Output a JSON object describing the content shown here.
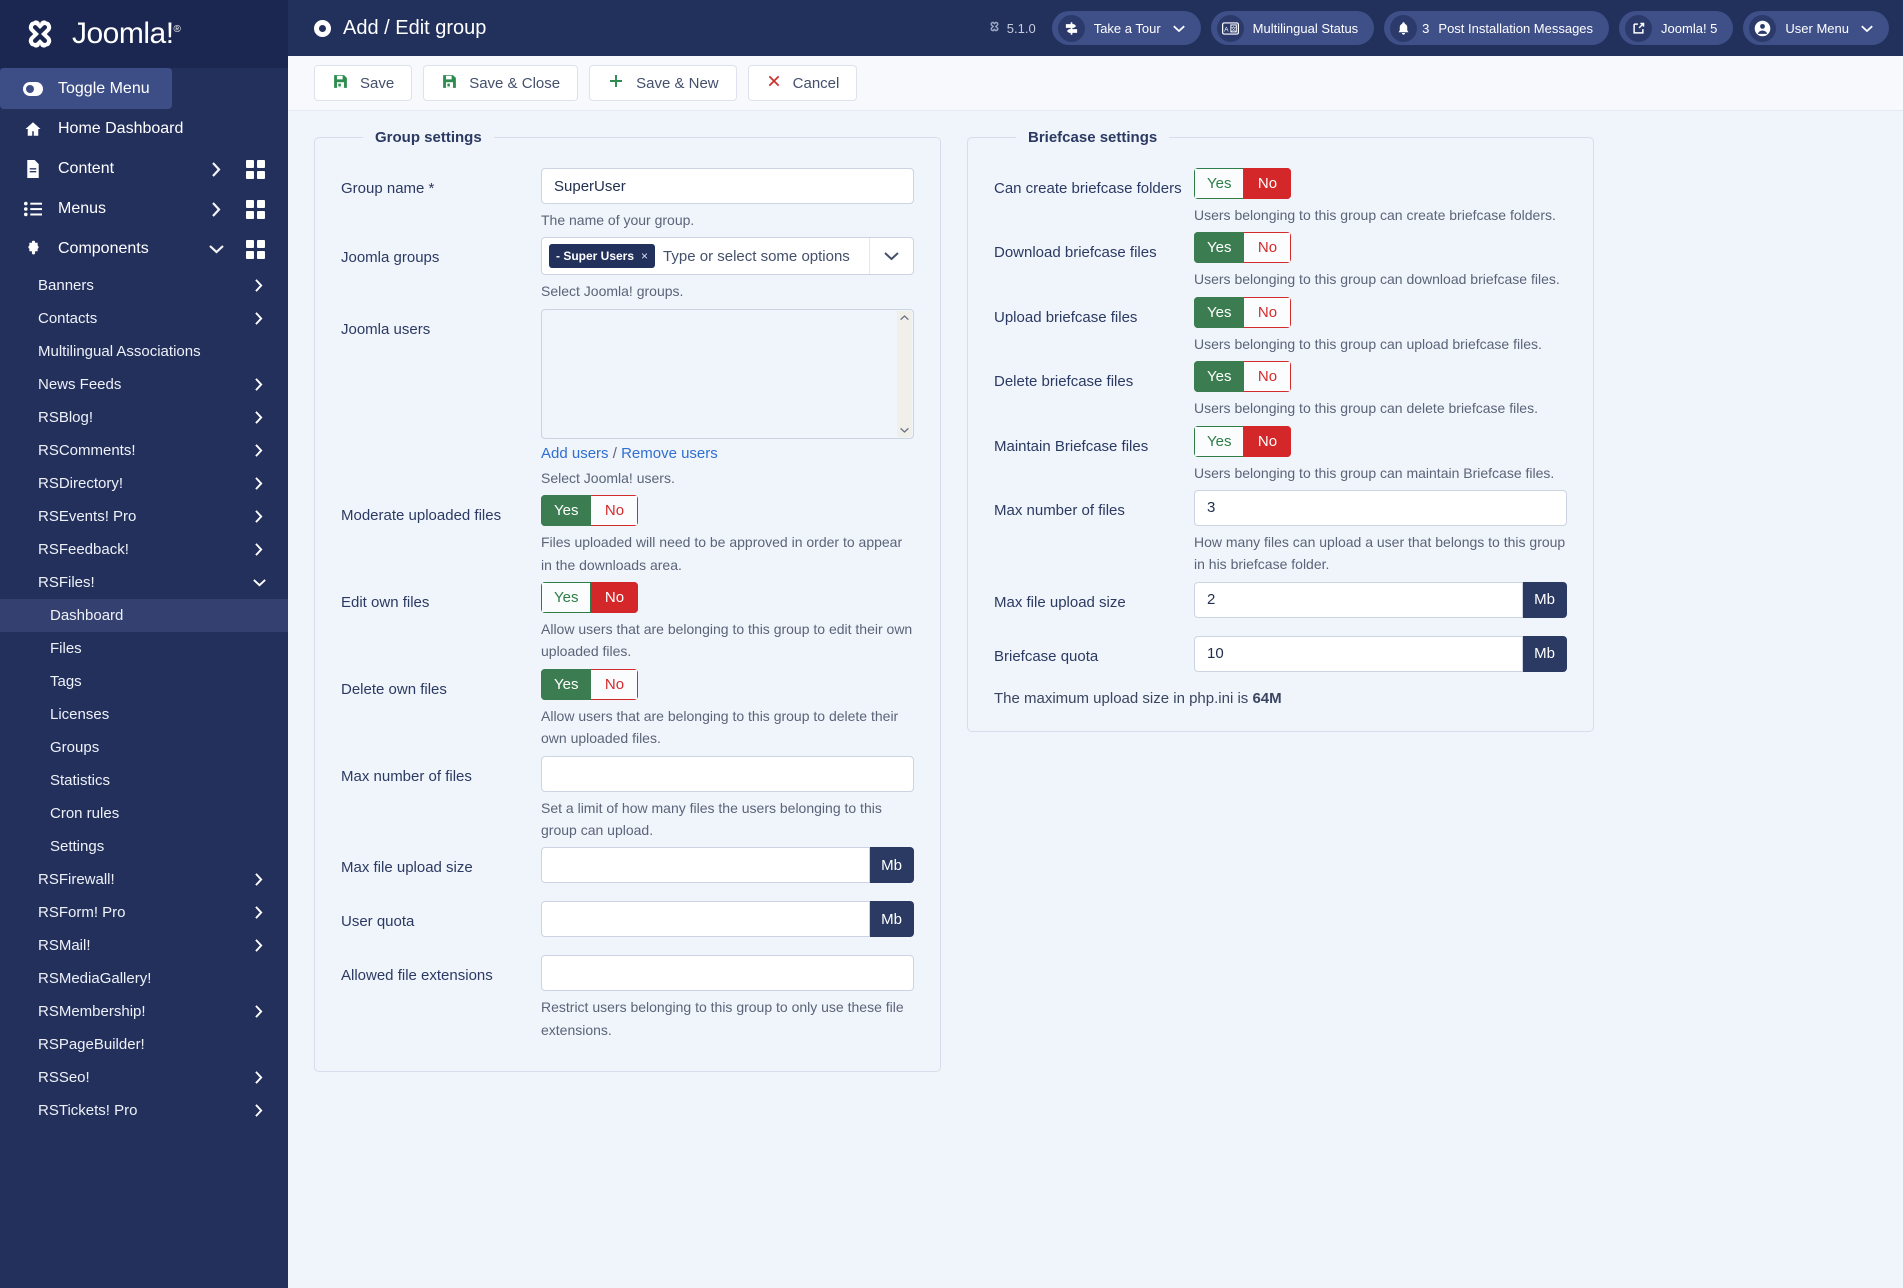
{
  "brand": {
    "name": "Joomla!",
    "reg": "®"
  },
  "sidebar": {
    "toggle_label": "Toggle Menu",
    "top_items": [
      {
        "label": "Home Dashboard",
        "icon": "home-icon",
        "chevron": false,
        "grid": false
      },
      {
        "label": "Content",
        "icon": "document-icon",
        "chevron": true,
        "grid": true
      },
      {
        "label": "Menus",
        "icon": "list-icon",
        "chevron": true,
        "grid": true
      },
      {
        "label": "Components",
        "icon": "puzzle-icon",
        "chevron": "down",
        "grid": true
      }
    ],
    "components": [
      {
        "label": "Banners",
        "chevron": true
      },
      {
        "label": "Contacts",
        "chevron": true
      },
      {
        "label": "Multilingual Associations",
        "chevron": false
      },
      {
        "label": "News Feeds",
        "chevron": true
      },
      {
        "label": "RSBlog!",
        "chevron": true
      },
      {
        "label": "RSComments!",
        "chevron": true
      },
      {
        "label": "RSDirectory!",
        "chevron": true
      },
      {
        "label": "RSEvents! Pro",
        "chevron": true
      },
      {
        "label": "RSFeedback!",
        "chevron": true
      },
      {
        "label": "RSFiles!",
        "chevron": "down"
      }
    ],
    "rsfiles_children": [
      {
        "label": "Dashboard",
        "active": true
      },
      {
        "label": "Files",
        "active": false
      },
      {
        "label": "Tags",
        "active": false
      },
      {
        "label": "Licenses",
        "active": false
      },
      {
        "label": "Groups",
        "active": false
      },
      {
        "label": "Statistics",
        "active": false
      },
      {
        "label": "Cron rules",
        "active": false
      },
      {
        "label": "Settings",
        "active": false
      }
    ],
    "components_after": [
      {
        "label": "RSFirewall!",
        "chevron": true
      },
      {
        "label": "RSForm! Pro",
        "chevron": true
      },
      {
        "label": "RSMail!",
        "chevron": true
      },
      {
        "label": "RSMediaGallery!",
        "chevron": false
      },
      {
        "label": "RSMembership!",
        "chevron": true
      },
      {
        "label": "RSPageBuilder!",
        "chevron": false
      },
      {
        "label": "RSSeo!",
        "chevron": true
      },
      {
        "label": "RSTickets! Pro",
        "chevron": true
      }
    ]
  },
  "header": {
    "title": "Add / Edit group",
    "version": "5.1.0",
    "take_a_tour": "Take a Tour",
    "multilingual_status": "Multilingual Status",
    "messages_count": "3",
    "post_installation_messages": "Post Installation Messages",
    "joomla_5": "Joomla! 5",
    "user_menu": "User Menu"
  },
  "toolbar": {
    "save": "Save",
    "save_close": "Save & Close",
    "save_new": "Save & New",
    "cancel": "Cancel"
  },
  "group_settings": {
    "legend": "Group settings",
    "group_name": {
      "label": "Group name *",
      "value": "SuperUser",
      "hint": "The name of your group."
    },
    "joomla_groups": {
      "label": "Joomla groups",
      "chip": "- Super Users",
      "chip_remove": "×",
      "placeholder": "Type or select some options",
      "hint": "Select Joomla! groups."
    },
    "joomla_users": {
      "label": "Joomla users",
      "add_users": "Add users",
      "separator": " / ",
      "remove_users": "Remove users",
      "hint": "Select Joomla! users."
    },
    "moderate_uploaded_files": {
      "label": "Moderate uploaded files",
      "yes": "Yes",
      "no": "No",
      "value": "Yes",
      "hint": "Files uploaded will need to be approved in order to appear in the downloads area."
    },
    "edit_own_files": {
      "label": "Edit own files",
      "yes": "Yes",
      "no": "No",
      "value": "No",
      "hint": "Allow users that are belonging to this group to edit their own uploaded files."
    },
    "delete_own_files": {
      "label": "Delete own files",
      "yes": "Yes",
      "no": "No",
      "value": "Yes",
      "hint": "Allow users that are belonging to this group to delete their own uploaded files."
    },
    "max_number_of_files": {
      "label": "Max number of files",
      "value": "",
      "hint": "Set a limit of how many files the users belonging to this group can upload."
    },
    "max_file_upload_size": {
      "label": "Max file upload size",
      "value": "",
      "unit": "Mb"
    },
    "user_quota": {
      "label": "User quota",
      "value": "",
      "unit": "Mb"
    },
    "allowed_file_extensions": {
      "label": "Allowed file extensions",
      "value": "",
      "hint": "Restrict users belonging to this group to only use these file extensions."
    }
  },
  "briefcase_settings": {
    "legend": "Briefcase settings",
    "can_create_folders": {
      "label": "Can create briefcase folders",
      "yes": "Yes",
      "no": "No",
      "value": "No",
      "hint": "Users belonging to this group can create briefcase folders."
    },
    "download_files": {
      "label": "Download briefcase files",
      "yes": "Yes",
      "no": "No",
      "value": "Yes",
      "hint": "Users belonging to this group can download briefcase files."
    },
    "upload_files": {
      "label": "Upload briefcase files",
      "yes": "Yes",
      "no": "No",
      "value": "Yes",
      "hint": "Users belonging to this group can upload briefcase files."
    },
    "delete_files": {
      "label": "Delete briefcase files",
      "yes": "Yes",
      "no": "No",
      "value": "Yes",
      "hint": "Users belonging to this group can delete briefcase files."
    },
    "maintain_files": {
      "label": "Maintain Briefcase files",
      "yes": "Yes",
      "no": "No",
      "value": "No",
      "hint": "Users belonging to this group can maintain Briefcase files."
    },
    "max_number_of_files": {
      "label": "Max number of files",
      "value": "3",
      "hint": "How many files can upload a user that belongs to this group in his briefcase folder."
    },
    "max_file_upload_size": {
      "label": "Max file upload size",
      "value": "2",
      "unit": "Mb"
    },
    "briefcase_quota": {
      "label": "Briefcase quota",
      "value": "10",
      "unit": "Mb"
    },
    "php_note_prefix": "The maximum upload size in php.ini is ",
    "php_note_value": "64M"
  }
}
